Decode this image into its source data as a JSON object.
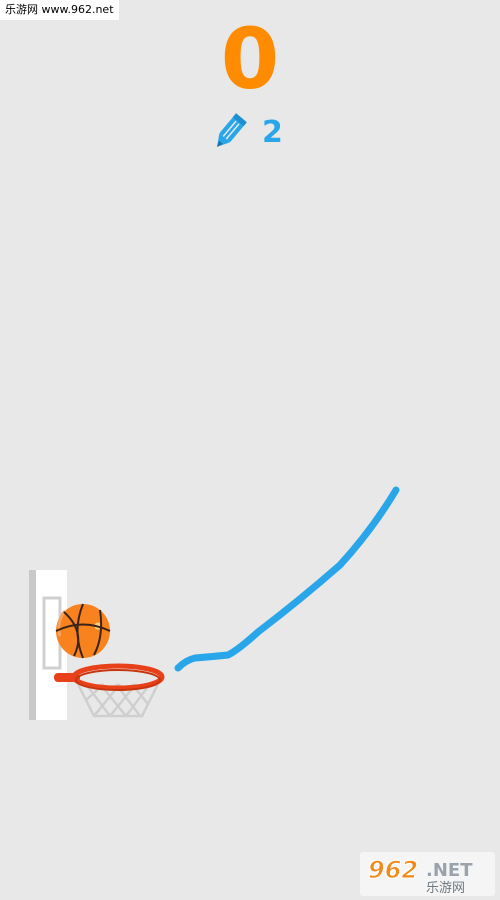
{
  "watermark": {
    "text": "乐游网 www.962.net"
  },
  "game": {
    "score": "0",
    "pencils_remaining": "2"
  },
  "icons": {
    "pencil": "pencil-icon",
    "ball": "basketball-icon",
    "hoop": "basketball-hoop-icon"
  },
  "colors": {
    "background": "#e8e8e8",
    "score": "#ff8c00",
    "pencil": "#29a6ea",
    "drawn_line": "#29a6ea",
    "hoop_rim": "#e8411a",
    "ball": "#f7821e"
  },
  "logo": {
    "main": "962.NET",
    "sub": "乐游网"
  }
}
